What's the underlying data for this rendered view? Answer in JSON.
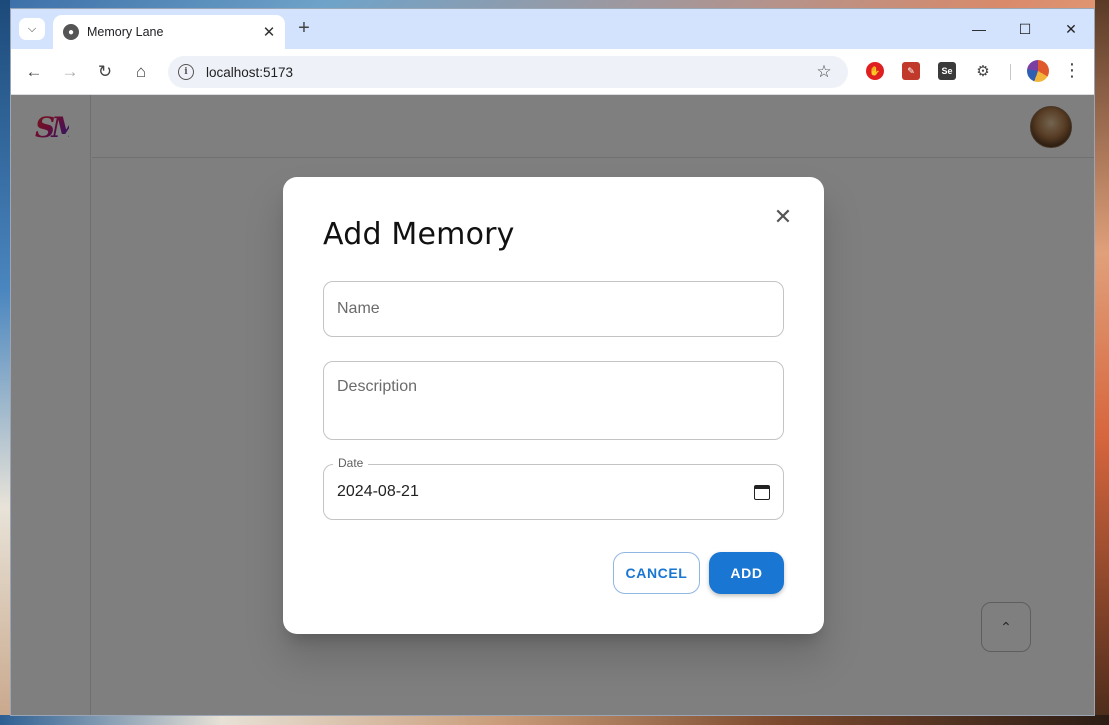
{
  "browser": {
    "tab": {
      "title": "Memory Lane",
      "favicon": "globe-icon"
    },
    "url": "localhost:5173",
    "extensions": [
      "adblock-icon",
      "clipper-icon",
      "selenium-icon",
      "puzzle-icon"
    ]
  },
  "app": {
    "logo": "SM"
  },
  "dialog": {
    "title": "Add Memory",
    "name_placeholder": "Name",
    "description_placeholder": "Description",
    "date_label": "Date",
    "date_value": "2024-08-21",
    "cancel_label": "CANCEL",
    "add_label": "ADD"
  },
  "colors": {
    "primary": "#1976d2",
    "backdrop": "rgba(0,0,0,0.5)",
    "tab_strip": "#d3e3fd"
  }
}
